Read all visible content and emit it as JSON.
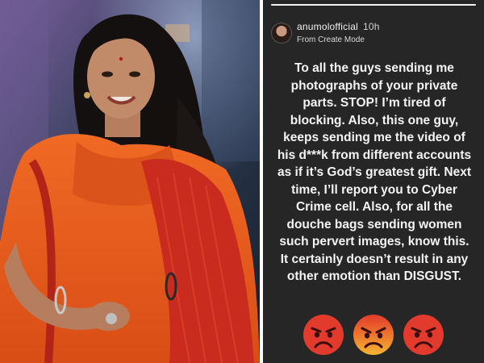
{
  "story": {
    "username": "anumolofficial",
    "time": "10h",
    "source": "From Create Mode",
    "text": "To all the guys sending me photographs of your private parts. STOP! I’m tired of blocking. Also, this one guy, keeps sending me the video of his d***k from different accounts as if it’s God’s greatest gift. Next time, I’ll report you to Cyber Crime cell. Also, for all the douche bags sending women such pervert images, know this. It certainly doesn’t result in any other emotion than DISGUST.",
    "progress_fraction": 1.0,
    "emojis": [
      "angry-face-icon",
      "angry-face-icon",
      "angry-face-icon"
    ]
  },
  "colors": {
    "story_bg": "#262626",
    "saree_orange": "#e8581e",
    "saree_border": "#c42d1f",
    "emoji_red": "#e23b2e"
  }
}
